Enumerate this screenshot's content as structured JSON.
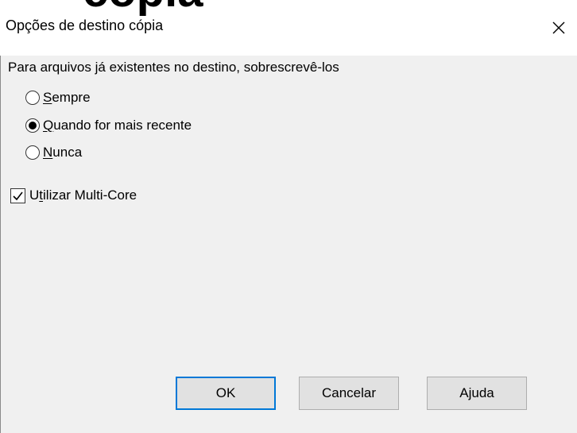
{
  "background_clip_text": "cópia",
  "dialog": {
    "title": "Opções de destino cópia",
    "close_icon": "close-icon"
  },
  "overwrite_group": {
    "label": "Para arquivos já existentes no destino, sobrescrevê-los",
    "options": [
      {
        "accel": "S",
        "rest": "empre",
        "selected": false
      },
      {
        "accel": "Q",
        "rest": "uando for mais recente",
        "selected": true
      },
      {
        "accel": "N",
        "rest": "unca",
        "selected": false
      }
    ]
  },
  "multicore": {
    "pre": "U",
    "accel": "t",
    "rest": "ilizar Multi-Core",
    "checked": true
  },
  "buttons": {
    "ok": "OK",
    "cancel": "Cancelar",
    "help": "Ajuda"
  },
  "colors": {
    "default_button_border": "#0078d7",
    "dialog_bg": "#f0f0f0"
  }
}
